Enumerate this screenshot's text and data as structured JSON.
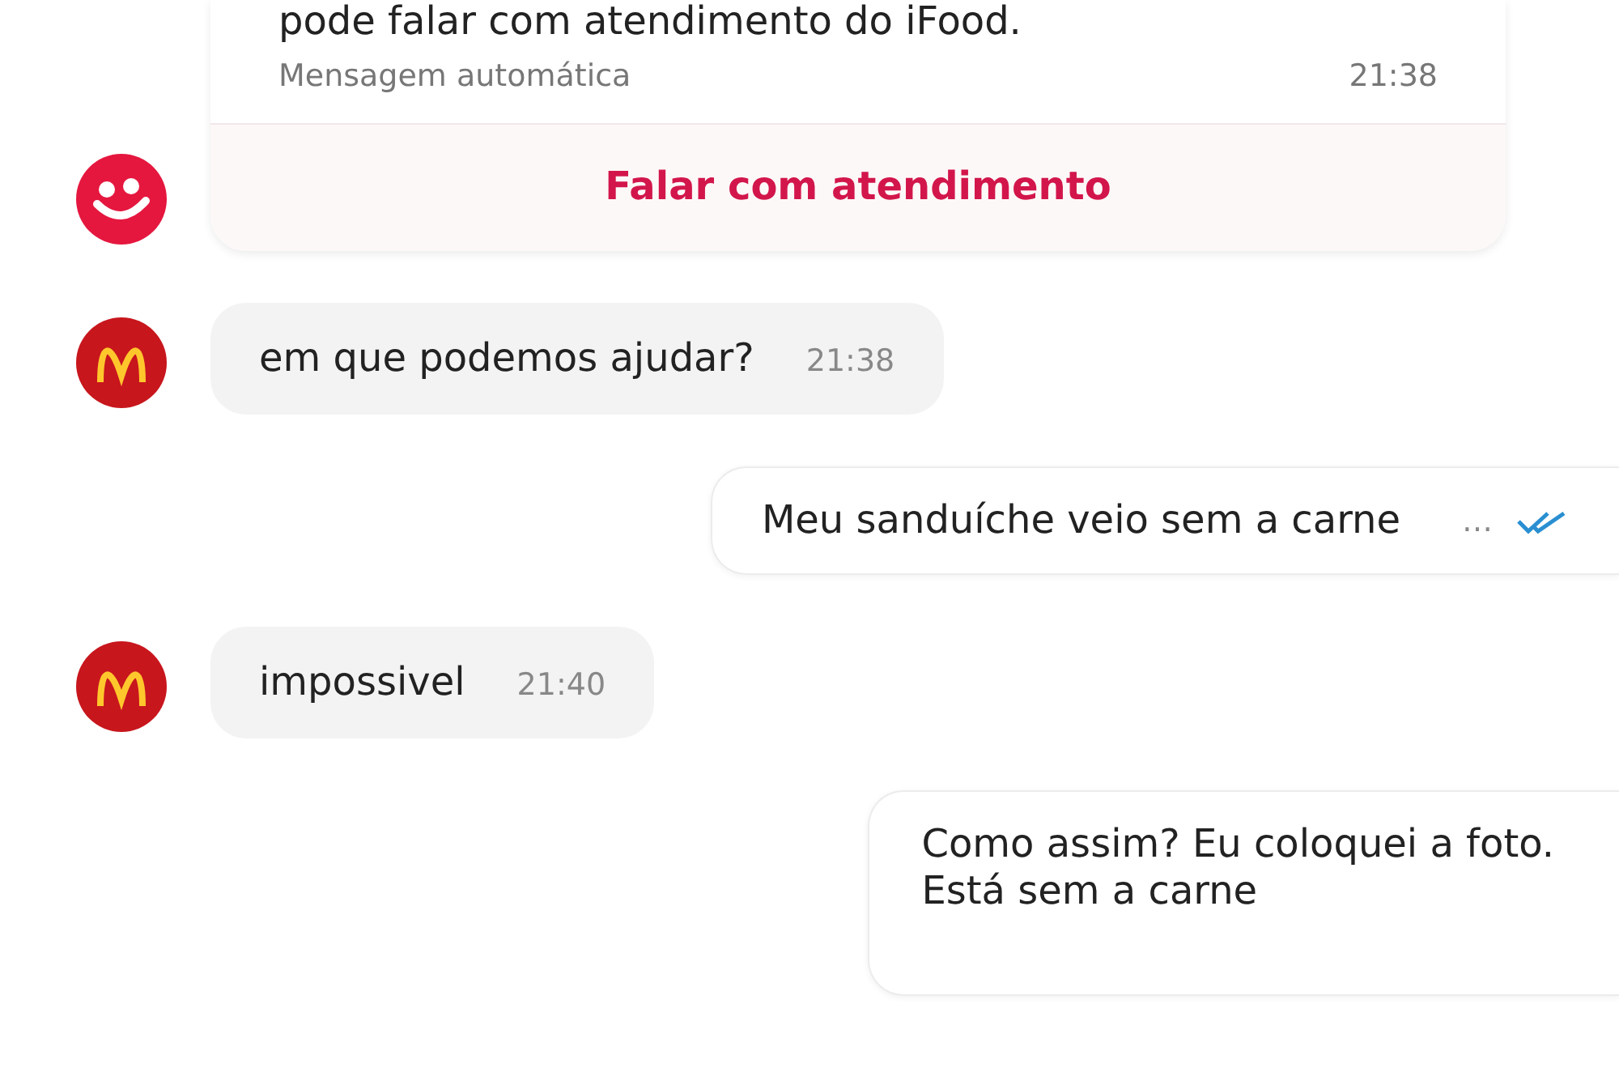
{
  "messages": [
    {
      "kind": "auto",
      "avatar": {
        "kind": "smile"
      },
      "text": "pode falar com atendimento do iFood.",
      "note": "Mensagem automática",
      "time": "21:38",
      "action": "Falar com atendimento"
    },
    {
      "kind": "incoming",
      "avatar": {
        "kind": "arches"
      },
      "text": "em que podemos ajudar?",
      "time": "21:38"
    },
    {
      "kind": "outgoing",
      "text": "Meu sanduíche veio sem a carne",
      "time": "…",
      "read": true
    },
    {
      "kind": "incoming",
      "avatar": {
        "kind": "arches"
      },
      "text": "impossivel",
      "time": "21:40"
    },
    {
      "kind": "outgoing",
      "text": "Como assim? Eu coloquei a foto.\nEstá sem a carne"
    }
  ]
}
